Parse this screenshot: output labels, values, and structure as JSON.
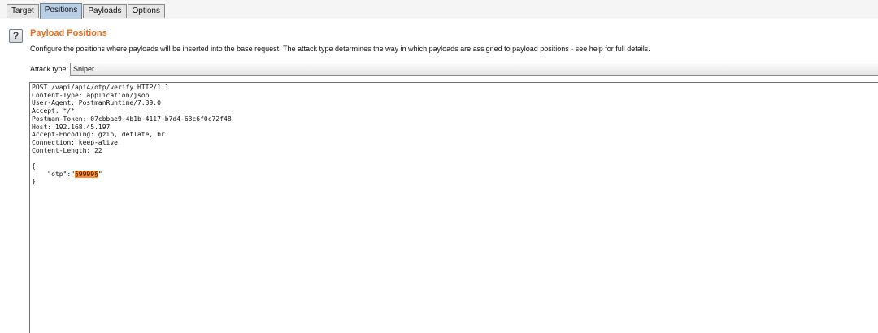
{
  "tabs": [
    {
      "label": "Target",
      "active": false
    },
    {
      "label": "Positions",
      "active": true
    },
    {
      "label": "Payloads",
      "active": false
    },
    {
      "label": "Options",
      "active": false
    }
  ],
  "panel": {
    "help_symbol": "?",
    "title": "Payload Positions",
    "description": "Configure the positions where payloads will be inserted into the base request. The attack type determines the way in which payloads are assigned to payload positions - see help for full details.",
    "attack_type_label": "Attack type:",
    "attack_type_value": "Sniper"
  },
  "request": {
    "before_payload": "POST /vapi/api4/otp/verify HTTP/1.1\nContent-Type: application/json\nUser-Agent: PostmanRuntime/7.39.0\nAccept: */*\nPostman-Token: 07cbbae9-4b1b-4117-b7d4-63c6f0c72f48\nHost: 192.168.45.197\nAccept-Encoding: gzip, deflate, br\nConnection: keep-alive\nContent-Length: 22\n\n{\n    \"otp\":\"",
    "payload_marker": "§9999§",
    "after_payload": "\"\n}"
  },
  "colors": {
    "title": "#e36f1e",
    "active_tab": "#b8cfe6",
    "payload_highlight": "#ff8c24"
  },
  "icons": {
    "help": "question-mark-icon"
  }
}
